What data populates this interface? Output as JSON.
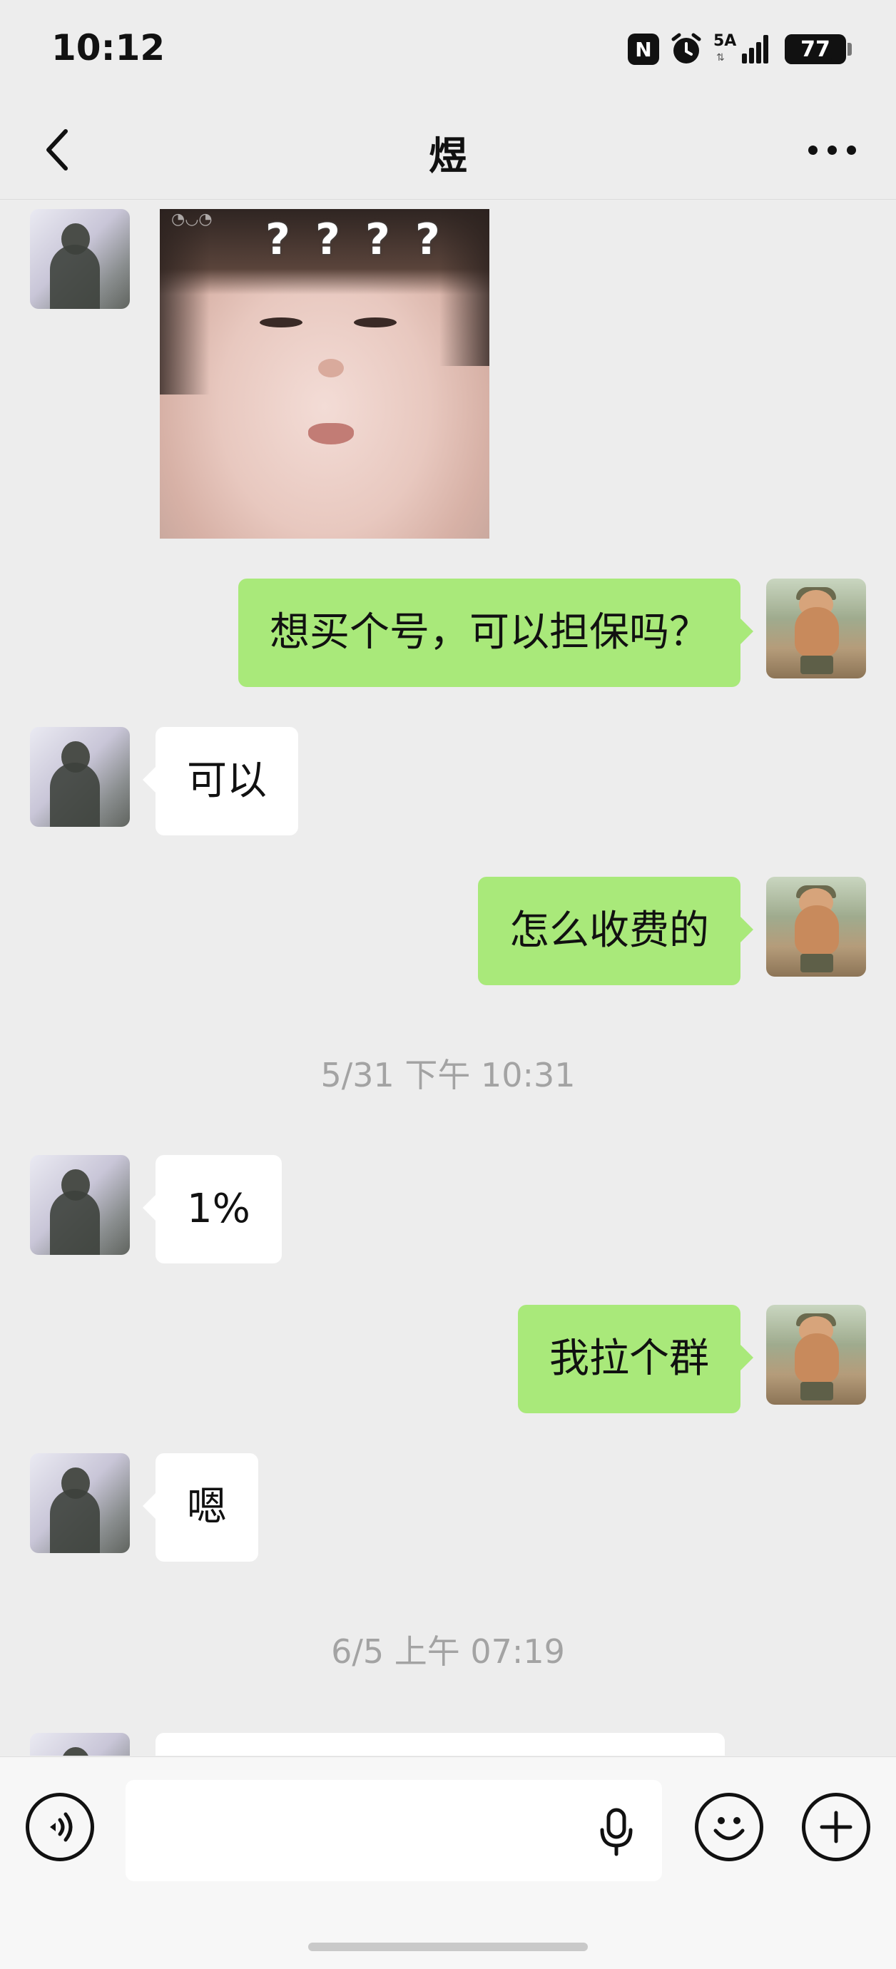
{
  "status_bar": {
    "time": "10:12",
    "nfc_label": "N",
    "network_label": "5A",
    "battery": "77",
    "battery_level": 0.77
  },
  "header": {
    "title": "煜",
    "back_icon": "chevron-left-icon",
    "more_icon": "more-horizontal-icon"
  },
  "messages": [
    {
      "type": "sticker",
      "from": "friend",
      "description_icon": "baby-face-sticker",
      "overlay_text": "? ? ? ?"
    },
    {
      "type": "text",
      "from": "me",
      "text": "想买个号，可以担保吗？"
    },
    {
      "type": "text",
      "from": "friend",
      "text": "可以"
    },
    {
      "type": "text",
      "from": "me",
      "text": "怎么收费的"
    },
    {
      "type": "timestamp",
      "text": "5/31 下午 10:31"
    },
    {
      "type": "text",
      "from": "friend",
      "text": "1%"
    },
    {
      "type": "text",
      "from": "me",
      "text": "我拉个群"
    },
    {
      "type": "text",
      "from": "friend",
      "text": "嗯"
    },
    {
      "type": "timestamp",
      "text": "6/5 上午 07:19"
    },
    {
      "type": "text",
      "from": "friend",
      "text": ""
    }
  ],
  "input_bar": {
    "value": "",
    "voice_icon": "voice-mode-icon",
    "mic_icon": "microphone-icon",
    "emoji_icon": "emoji-icon",
    "plus_icon": "plus-circle-icon"
  },
  "colors": {
    "background": "#ededed",
    "my_bubble": "#a9e97a",
    "friend_bubble": "#ffffff",
    "timestamp": "#a3a3a3"
  }
}
